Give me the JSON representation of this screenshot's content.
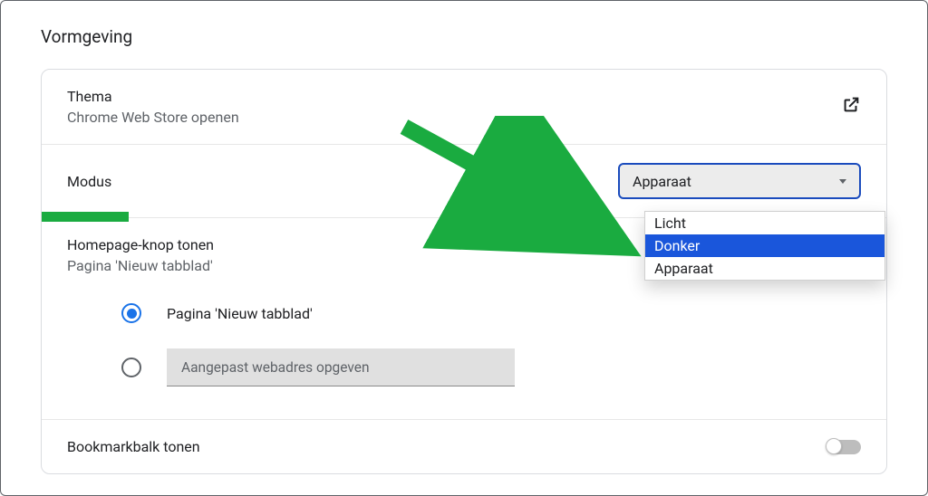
{
  "section_title": "Vormgeving",
  "theme": {
    "label": "Thema",
    "sublabel": "Chrome Web Store openen"
  },
  "mode": {
    "label": "Modus",
    "selected": "Apparaat",
    "options": [
      "Licht",
      "Donker",
      "Apparaat"
    ],
    "highlighted_index": 1
  },
  "homepage": {
    "label": "Homepage-knop tonen",
    "sublabel": "Pagina 'Nieuw tabblad'",
    "radio_new_tab": "Pagina 'Nieuw tabblad'",
    "radio_custom_placeholder": "Aangepast webadres opgeven"
  },
  "bookmarkbar": {
    "label": "Bookmarkbalk tonen",
    "enabled": false
  }
}
